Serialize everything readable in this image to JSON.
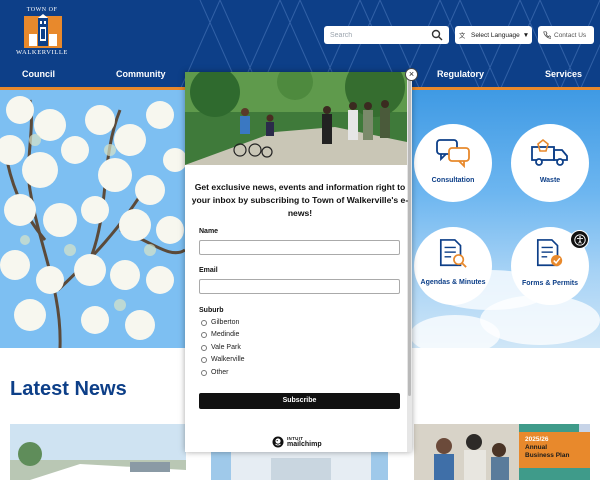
{
  "logo": {
    "top_text": "TOWN OF",
    "bottom_text": "WALKERVILLE"
  },
  "search": {
    "placeholder": "Search",
    "icon": "search-icon"
  },
  "language": {
    "label": "Select Language",
    "arrow": "▼",
    "icon": "translate-icon"
  },
  "contact": {
    "label": "Contact Us",
    "icon": "phone-icon"
  },
  "nav": {
    "items": [
      {
        "label": "Council"
      },
      {
        "label": "Community"
      },
      {
        "label": "Regulatory"
      },
      {
        "label": "Services"
      }
    ]
  },
  "services": [
    {
      "label": "Consultation",
      "icon": "speech-bubbles-icon"
    },
    {
      "label": "Waste",
      "icon": "waste-truck-icon"
    },
    {
      "label": "Agendas & Minutes",
      "icon": "document-search-icon"
    },
    {
      "label": "Forms & Permits",
      "icon": "form-check-icon"
    }
  ],
  "news": {
    "title": "Latest News",
    "card_plan": {
      "year": "2025/26",
      "line1": "Annual",
      "line2": "Business Plan"
    }
  },
  "modal": {
    "close": "×",
    "heading": "Get exclusive news, events and information right to your inbox by subscribing to Town of Walkerville's e-news!",
    "name_label": "Name",
    "email_label": "Email",
    "suburb_label": "Suburb",
    "suburbs": [
      "Gilberton",
      "Medindie",
      "Vale Park",
      "Walkerville",
      "Other"
    ],
    "subscribe_label": "Subscribe",
    "brand_top": "INTUIT",
    "brand_bottom": "mailchimp"
  },
  "colors": {
    "header": "#0d3f88",
    "accent": "#e8892c",
    "link": "#0d3f88"
  }
}
